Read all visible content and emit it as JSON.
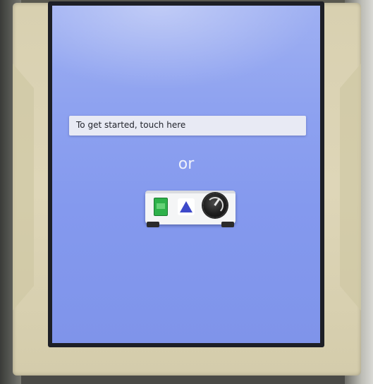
{
  "screen": {
    "touch_prompt": "To get started, touch here",
    "or_text": "or",
    "device_hint": {
      "icons": [
        "green-button-icon",
        "triangle-button-icon",
        "rotary-knob-icon"
      ]
    }
  },
  "colors": {
    "screen_bg": "#8ea2f0",
    "prompt_bar_bg": "#e8eaf4",
    "bezel": "#d8d0b0",
    "green_button": "#2db14a",
    "triangle_button": "#3d49c9",
    "knob": "#1e1e1e"
  }
}
